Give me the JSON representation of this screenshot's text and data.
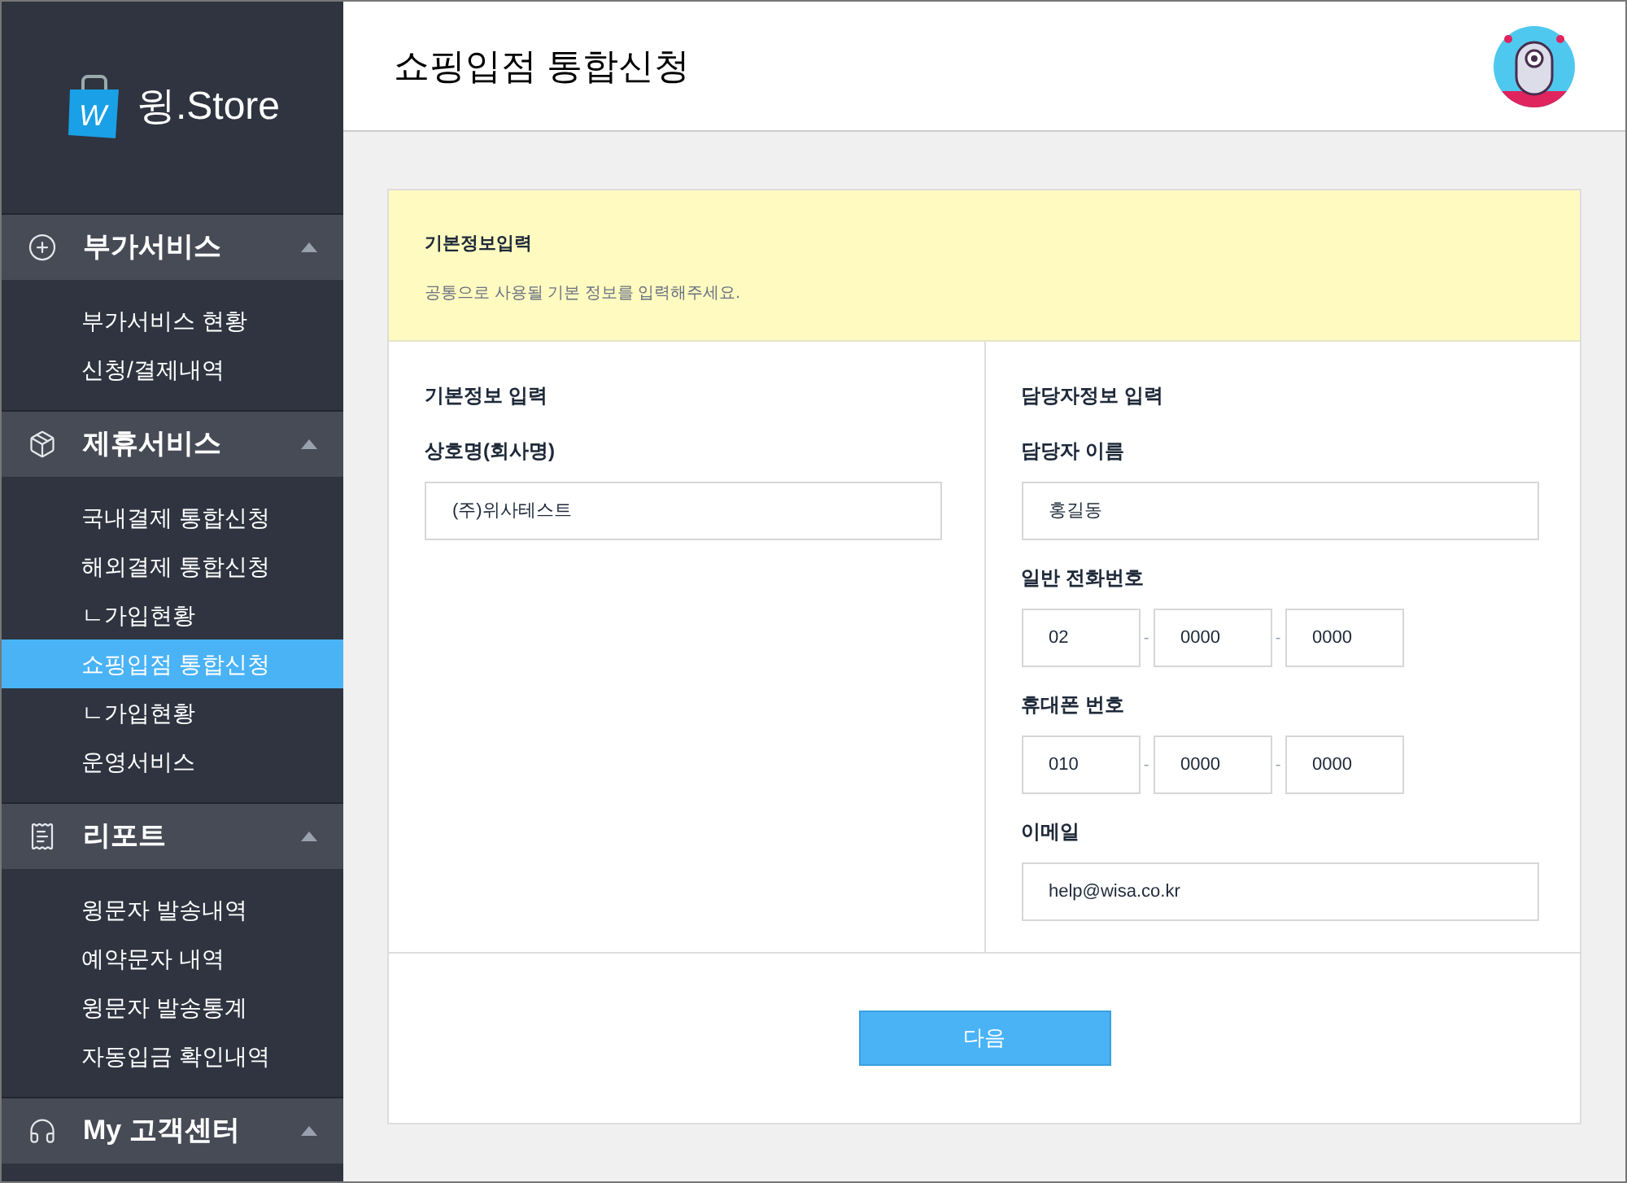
{
  "sidebar": {
    "logo": {
      "mark": "W",
      "text": "윙.Store"
    },
    "groups": [
      {
        "title": "부가서비스",
        "expanded": true,
        "items": [
          {
            "label": "부가서비스 현황",
            "selected": false
          },
          {
            "label": "신청/결제내역",
            "selected": false
          }
        ]
      },
      {
        "title": "제휴서비스",
        "expanded": true,
        "items": [
          {
            "label": "국내결제 통합신청",
            "selected": false
          },
          {
            "label": "해외결제 통합신청",
            "selected": false
          },
          {
            "label": "ㄴ가입현황",
            "selected": false
          },
          {
            "label": "쇼핑입점 통합신청",
            "selected": true
          },
          {
            "label": "ㄴ가입현황",
            "selected": false
          },
          {
            "label": "운영서비스",
            "selected": false
          }
        ]
      },
      {
        "title": "리포트",
        "expanded": true,
        "items": [
          {
            "label": "윙문자 발송내역",
            "selected": false
          },
          {
            "label": "예약문자 내역",
            "selected": false
          },
          {
            "label": "윙문자 발송통계",
            "selected": false
          },
          {
            "label": "자동입금 확인내역",
            "selected": false
          }
        ]
      },
      {
        "title": "My 고객센터",
        "expanded": true
      }
    ]
  },
  "header": {
    "title": "쇼핑입점 통합신청"
  },
  "notice": {
    "title": "기본정보입력",
    "text": "공통으로 사용될 기본 정보를 입력해주세요."
  },
  "sections": [
    {
      "title": "기본정보 입력",
      "fields": [
        {
          "kind": "text",
          "label": "상호명(회사명)",
          "value": "(주)위사테스트"
        }
      ]
    },
    {
      "title": "담당자정보 입력",
      "fields": [
        {
          "kind": "text",
          "label": "담당자 이름",
          "value": "홍길동"
        },
        {
          "kind": "phone",
          "label": "일반 전화번호",
          "parts": [
            "02",
            "0000",
            "0000"
          ],
          "separator": "-"
        },
        {
          "kind": "phone",
          "label": "휴대폰 번호",
          "parts": [
            "010",
            "0000",
            "0000"
          ],
          "separator": "-"
        },
        {
          "kind": "text",
          "label": "이메일",
          "value": "help@wisa.co.kr"
        }
      ]
    }
  ],
  "next_button": "다음"
}
